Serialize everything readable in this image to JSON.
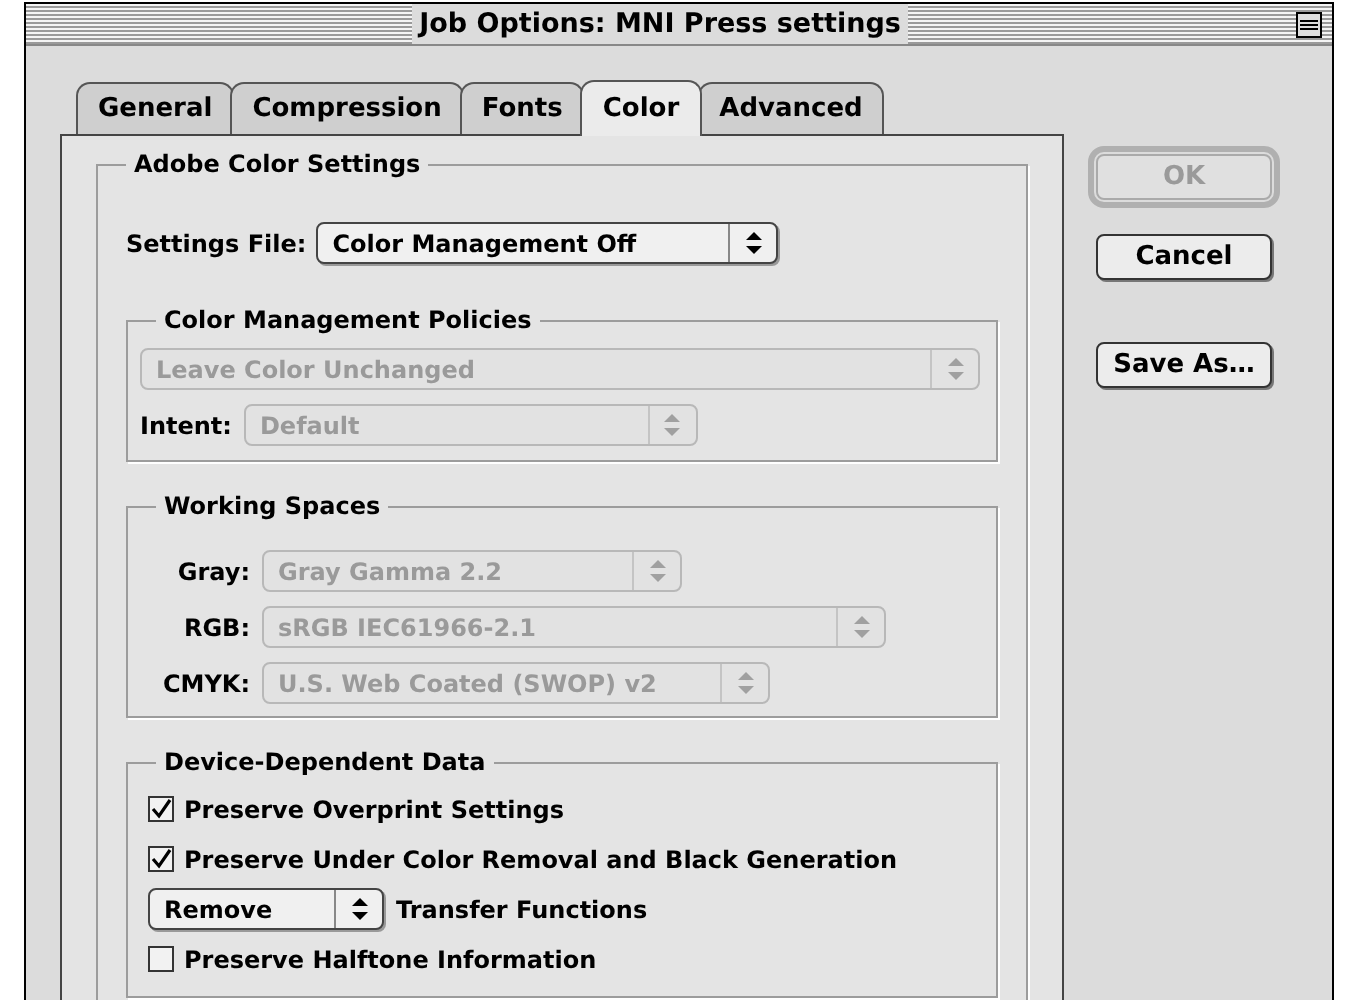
{
  "window": {
    "title": "Job Options: MNI Press settings"
  },
  "tabs": [
    {
      "label": "General",
      "selected": false
    },
    {
      "label": "Compression",
      "selected": false
    },
    {
      "label": "Fonts",
      "selected": false
    },
    {
      "label": "Color",
      "selected": true
    },
    {
      "label": "Advanced",
      "selected": false
    }
  ],
  "adobe_color_settings": {
    "title": "Adobe Color Settings",
    "settings_file": {
      "label": "Settings File:",
      "value": "Color Management Off",
      "disabled": false
    },
    "color_management_policies": {
      "title": "Color Management Policies",
      "policy": {
        "value": "Leave Color Unchanged",
        "disabled": true
      },
      "intent": {
        "label": "Intent:",
        "value": "Default",
        "disabled": true
      }
    },
    "working_spaces": {
      "title": "Working Spaces",
      "fields": [
        {
          "label": "Gray:",
          "value": "Gray Gamma 2.2",
          "disabled": true
        },
        {
          "label": "RGB:",
          "value": "sRGB IEC61966-2.1",
          "disabled": true
        },
        {
          "label": "CMYK:",
          "value": "U.S. Web Coated (SWOP) v2",
          "disabled": true
        }
      ]
    },
    "device_dependent_data": {
      "title": "Device-Dependent Data",
      "items": [
        {
          "kind": "checkbox",
          "label": "Preserve Overprint Settings",
          "checked": true
        },
        {
          "kind": "checkbox",
          "label": "Preserve Under Color Removal and Black Generation",
          "checked": true
        },
        {
          "kind": "select",
          "popup_value": "Remove",
          "label": "Transfer Functions",
          "disabled": false
        },
        {
          "kind": "checkbox",
          "label": "Preserve Halftone Information",
          "checked": false
        }
      ]
    }
  },
  "buttons": [
    {
      "label": "OK",
      "disabled": true,
      "default": true
    },
    {
      "label": "Cancel",
      "disabled": false,
      "default": false
    },
    {
      "label": "Save As…",
      "disabled": false,
      "default": false
    }
  ]
}
